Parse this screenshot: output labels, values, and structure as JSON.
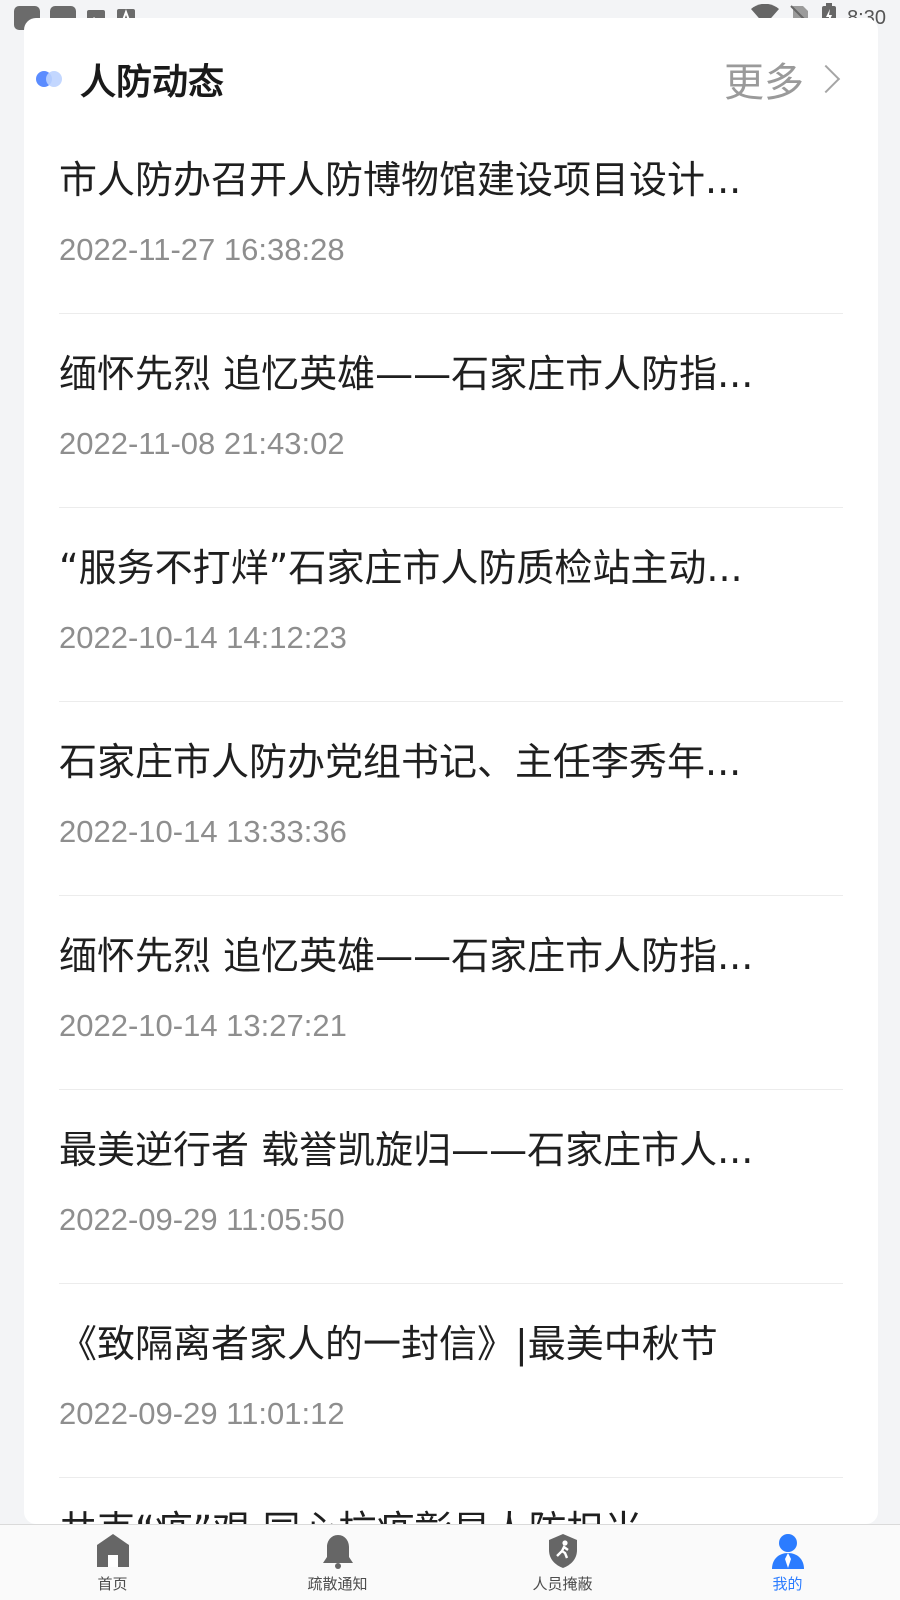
{
  "status_bar": {
    "time": "8:30"
  },
  "section": {
    "title": "人防动态",
    "more_label": "更多"
  },
  "news": [
    {
      "title": "市人防办召开人防博物馆建设项目设计...",
      "time": "2022-11-27 16:38:28"
    },
    {
      "title": "缅怀先烈 追忆英雄——石家庄市人防指...",
      "time": "2022-11-08 21:43:02"
    },
    {
      "title": "“服务不打烊”石家庄市人防质检站主动...",
      "time": "2022-10-14 14:12:23"
    },
    {
      "title": "石家庄市人防办党组书记、主任李秀年...",
      "time": "2022-10-14 13:33:36"
    },
    {
      "title": "缅怀先烈 追忆英雄——石家庄市人防指...",
      "time": "2022-10-14 13:27:21"
    },
    {
      "title": "最美逆行者 载誉凯旋归——石家庄市人...",
      "time": "2022-09-29 11:05:50"
    },
    {
      "title": "《致隔离者家人的一封信》|最美中秋节",
      "time": "2022-09-29 11:01:12"
    },
    {
      "title": "共克“疫”艰 同心抗疫彰显人防担当"
    }
  ],
  "bottom_nav": [
    {
      "label": "首页",
      "icon": "home-icon",
      "active": false
    },
    {
      "label": "疏散通知",
      "icon": "bell-icon",
      "active": false
    },
    {
      "label": "人员掩蔽",
      "icon": "shelter-shield-icon",
      "active": false
    },
    {
      "label": "我的",
      "icon": "user-icon",
      "active": true
    }
  ],
  "colors": {
    "accent": "#2b7cff",
    "title_dot": "#5b8cff"
  }
}
